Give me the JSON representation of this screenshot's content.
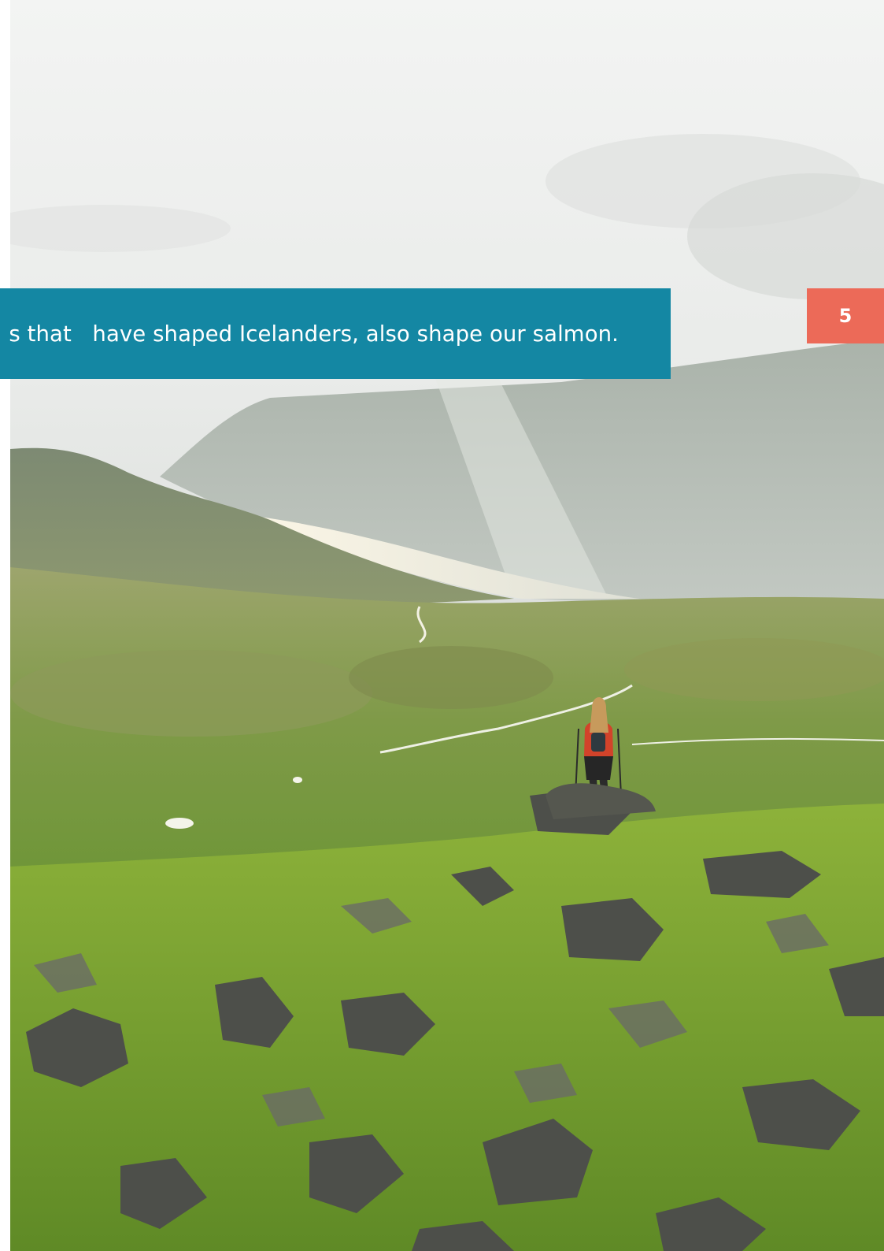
{
  "banner": {
    "text": "s that   have shaped Icelanders, also shape our salmon.",
    "color": "#1487a3"
  },
  "page_number": {
    "value": "5",
    "color": "#ec6a58"
  }
}
